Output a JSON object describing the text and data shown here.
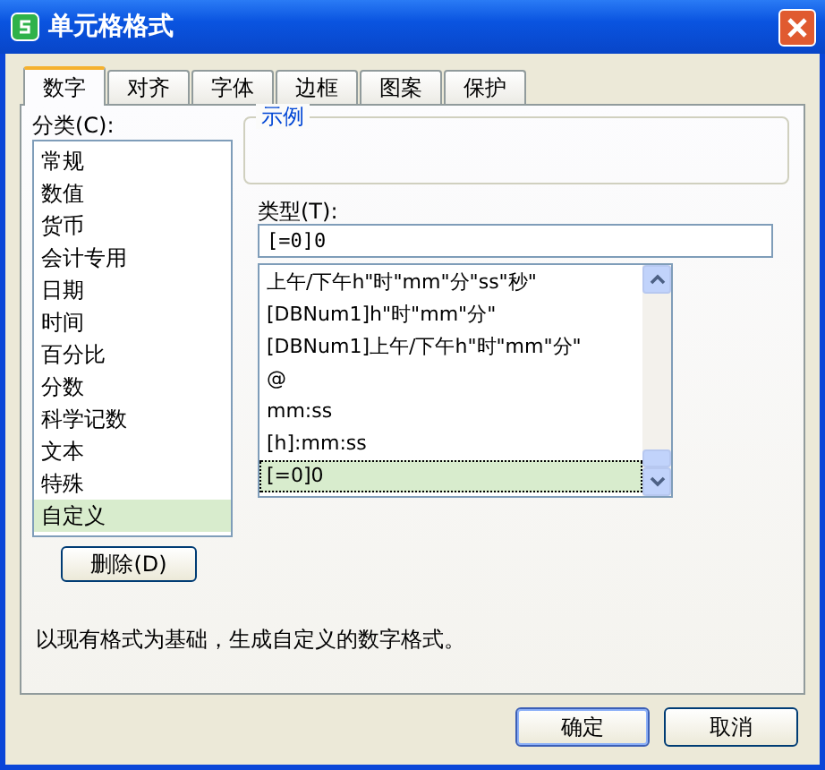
{
  "window": {
    "title": "单元格格式"
  },
  "tabs": [
    {
      "label": "数字",
      "selected": true
    },
    {
      "label": "对齐",
      "selected": false
    },
    {
      "label": "字体",
      "selected": false
    },
    {
      "label": "边框",
      "selected": false
    },
    {
      "label": "图案",
      "selected": false
    },
    {
      "label": "保护",
      "selected": false
    }
  ],
  "category": {
    "label": "分类(C):",
    "items": [
      {
        "label": "常规",
        "selected": false
      },
      {
        "label": "数值",
        "selected": false
      },
      {
        "label": "货币",
        "selected": false
      },
      {
        "label": "会计专用",
        "selected": false
      },
      {
        "label": "日期",
        "selected": false
      },
      {
        "label": "时间",
        "selected": false
      },
      {
        "label": "百分比",
        "selected": false
      },
      {
        "label": "分数",
        "selected": false
      },
      {
        "label": "科学记数",
        "selected": false
      },
      {
        "label": "文本",
        "selected": false
      },
      {
        "label": "特殊",
        "selected": false
      },
      {
        "label": "自定义",
        "selected": true
      }
    ]
  },
  "delete_button": "删除(D)",
  "sample": {
    "legend": "示例"
  },
  "type": {
    "label": "类型(T):",
    "value": "[=0]0",
    "items": [
      {
        "label": "上午/下午h\"时\"mm\"分\"ss\"秒\"",
        "selected": false
      },
      {
        "label": "[DBNum1]h\"时\"mm\"分\"",
        "selected": false
      },
      {
        "label": "[DBNum1]上午/下午h\"时\"mm\"分\"",
        "selected": false
      },
      {
        "label": "@",
        "selected": false
      },
      {
        "label": "mm:ss",
        "selected": false
      },
      {
        "label": "[h]:mm:ss",
        "selected": false
      },
      {
        "label": "[=0]0",
        "selected": true
      }
    ]
  },
  "description": "以现有格式为基础，生成自定义的数字格式。",
  "buttons": [
    "确定",
    "取消"
  ]
}
